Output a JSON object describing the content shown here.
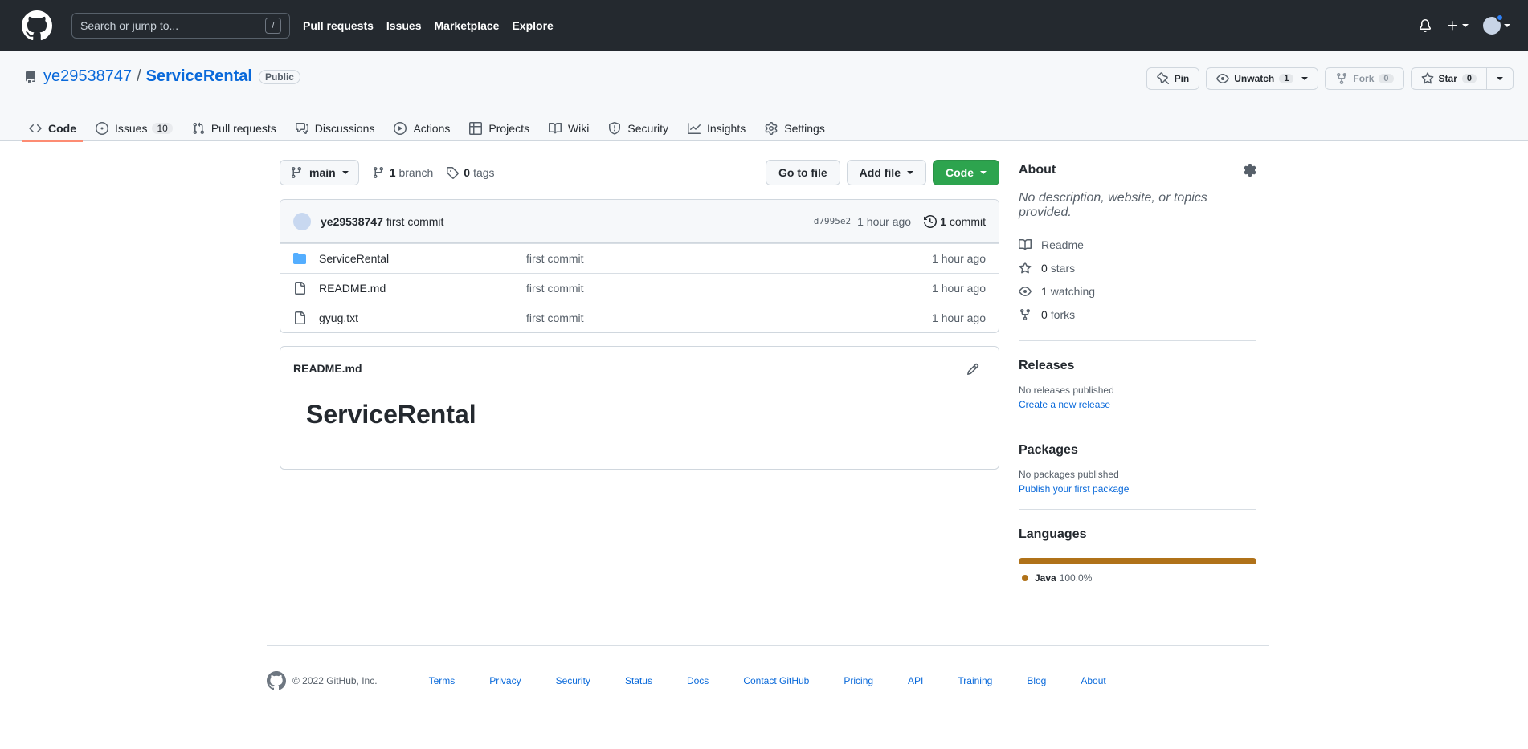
{
  "header": {
    "search_placeholder": "Search or jump to...",
    "slash_key": "/",
    "nav": [
      "Pull requests",
      "Issues",
      "Marketplace",
      "Explore"
    ]
  },
  "repo": {
    "owner": "ye29538747",
    "separator": "/",
    "name": "ServiceRental",
    "visibility": "Public",
    "actions": {
      "pin": "Pin",
      "unwatch": "Unwatch",
      "unwatch_count": "1",
      "fork": "Fork",
      "fork_count": "0",
      "star": "Star",
      "star_count": "0"
    },
    "tabs": [
      {
        "label": "Code",
        "icon": "code-icon"
      },
      {
        "label": "Issues",
        "count": "10",
        "icon": "issue-icon"
      },
      {
        "label": "Pull requests",
        "icon": "pull-request-icon"
      },
      {
        "label": "Discussions",
        "icon": "discussion-icon"
      },
      {
        "label": "Actions",
        "icon": "play-icon"
      },
      {
        "label": "Projects",
        "icon": "table-icon"
      },
      {
        "label": "Wiki",
        "icon": "book-icon"
      },
      {
        "label": "Security",
        "icon": "shield-icon"
      },
      {
        "label": "Insights",
        "icon": "graph-icon"
      },
      {
        "label": "Settings",
        "icon": "gear-icon"
      }
    ]
  },
  "toolbar": {
    "branch": "main",
    "branch_count": "1",
    "branch_label": "branch",
    "tag_count": "0",
    "tag_label": "tags",
    "goto_file": "Go to file",
    "add_file": "Add file",
    "code": "Code"
  },
  "commit": {
    "author": "ye29538747",
    "message": "first commit",
    "sha": "d7995e2",
    "age": "1 hour ago",
    "count": "1",
    "count_label": "commit"
  },
  "files": [
    {
      "name": "ServiceRental",
      "type": "folder",
      "message": "first commit",
      "age": "1 hour ago"
    },
    {
      "name": "README.md",
      "type": "file",
      "message": "first commit",
      "age": "1 hour ago"
    },
    {
      "name": "gyug.txt",
      "type": "file",
      "message": "first commit",
      "age": "1 hour ago"
    }
  ],
  "readme": {
    "filename": "README.md",
    "heading": "ServiceRental"
  },
  "about": {
    "title": "About",
    "description": "No description, website, or topics provided.",
    "readme": "Readme",
    "stars_count": "0",
    "stars_label": "stars",
    "watching_count": "1",
    "watching_label": "watching",
    "forks_count": "0",
    "forks_label": "forks"
  },
  "releases": {
    "title": "Releases",
    "empty": "No releases published",
    "link": "Create a new release"
  },
  "packages": {
    "title": "Packages",
    "empty": "No packages published",
    "link": "Publish your first package"
  },
  "languages": {
    "title": "Languages",
    "items": [
      {
        "name": "Java",
        "percent": "100.0%",
        "fraction": 1.0,
        "color": "#b07219"
      }
    ]
  },
  "footer": {
    "copyright": "© 2022 GitHub, Inc.",
    "links": [
      "Terms",
      "Privacy",
      "Security",
      "Status",
      "Docs",
      "Contact GitHub",
      "Pricing",
      "API",
      "Training",
      "Blog",
      "About"
    ]
  }
}
